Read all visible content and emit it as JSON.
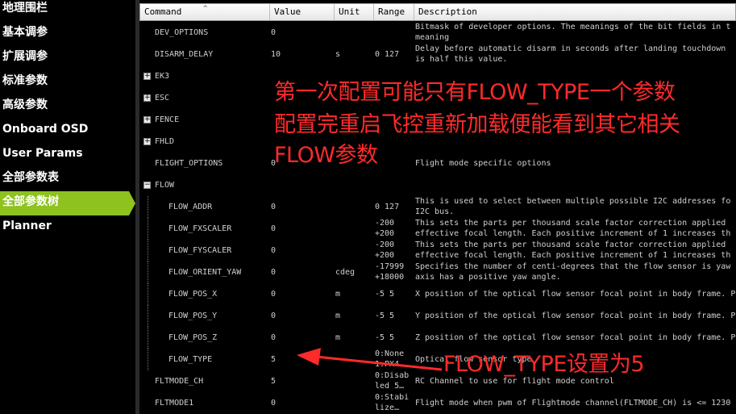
{
  "sidebar": {
    "items": [
      {
        "label": "地理围栏",
        "active": false
      },
      {
        "label": "基本调参",
        "active": false
      },
      {
        "label": "扩展调参",
        "active": false
      },
      {
        "label": "标准参数",
        "active": false
      },
      {
        "label": "高级参数",
        "active": false
      },
      {
        "label": "Onboard OSD",
        "active": false
      },
      {
        "label": "User Params",
        "active": false
      },
      {
        "label": "全部参数表",
        "active": false
      },
      {
        "label": "全部参数树",
        "active": true
      },
      {
        "label": "Planner",
        "active": false
      }
    ]
  },
  "columns": {
    "command": "Command",
    "value": "Value",
    "unit": "Unit",
    "range": "Range",
    "description": "Description"
  },
  "rows": [
    {
      "command": "DEV_OPTIONS",
      "value": "0",
      "unit": "",
      "range": "",
      "description": "Bitmask of developer options. The meanings of the bit fields in t",
      "description2": "meaning",
      "type": "param"
    },
    {
      "command": "DISARM_DELAY",
      "value": "10",
      "unit": "s",
      "range": "0 127",
      "description": "Delay before automatic disarm in seconds after landing touchdown",
      "description2": "is half this value.",
      "type": "param"
    },
    {
      "command": "EK3",
      "type": "group",
      "expander": "+"
    },
    {
      "command": "ESC",
      "type": "group",
      "expander": "+"
    },
    {
      "command": "FENCE",
      "type": "group",
      "expander": "+"
    },
    {
      "command": "FHLD",
      "type": "group",
      "expander": "+"
    },
    {
      "command": "FLIGHT_OPTIONS",
      "value": "0",
      "unit": "",
      "range": "",
      "description": "Flight mode specific options",
      "type": "param"
    },
    {
      "command": "FLOW",
      "type": "group",
      "expander": "−"
    },
    {
      "command": "FLOW_ADDR",
      "value": "0",
      "unit": "",
      "range": "0 127",
      "description": "This is used to select between multiple possible I2C addresses fo",
      "description2": "I2C bus.",
      "type": "child"
    },
    {
      "command": "FLOW_FXSCALER",
      "value": "0",
      "unit": "",
      "range": "-200",
      "range2": "+200",
      "description": "This sets the parts per thousand scale factor correction applied",
      "description2": "effective focal length. Each positive increment of 1 increases th",
      "type": "child"
    },
    {
      "command": "FLOW_FYSCALER",
      "value": "0",
      "unit": "",
      "range": "-200",
      "range2": "+200",
      "description": "This sets the parts per thousand scale factor correction applied",
      "description2": "effective focal length. Each positive increment of 1 increases th",
      "type": "child"
    },
    {
      "command": "FLOW_ORIENT_YAW",
      "value": "0",
      "unit": "cdeg",
      "range": "-17999",
      "range2": "+18000",
      "description": "Specifies the number of centi-degrees that the flow sensor is yaw",
      "description2": "axis has a positive yaw angle.",
      "type": "child"
    },
    {
      "command": "FLOW_POS_X",
      "value": "0",
      "unit": "m",
      "range": "-5 5",
      "description": "X position of the optical flow sensor focal point in body frame. P",
      "type": "child"
    },
    {
      "command": "FLOW_POS_Y",
      "value": "0",
      "unit": "m",
      "range": "-5 5",
      "description": "Y position of the optical flow sensor focal point in body frame. P",
      "type": "child"
    },
    {
      "command": "FLOW_POS_Z",
      "value": "0",
      "unit": "m",
      "range": "-5 5",
      "description": "Z position of the optical flow sensor focal point in body frame. P",
      "type": "child"
    },
    {
      "command": "FLOW_TYPE",
      "value": "5",
      "unit": "",
      "range": "0:None",
      "range2": "1:PX4…",
      "description": "Optical flow sensor type",
      "type": "child"
    },
    {
      "command": "FLTMODE_CH",
      "value": "5",
      "unit": "",
      "range": "0:Disab",
      "range2": "led 5…",
      "description": "RC Channel to use for flight mode control",
      "type": "param"
    },
    {
      "command": "FLTMODE1",
      "value": "0",
      "unit": "",
      "range": "0:Stabi",
      "range2": "lize…",
      "description": "Flight mode when pwm of Flightmode channel(FLTMODE_CH) is <= 1230",
      "type": "param"
    }
  ],
  "annotations": {
    "note_line1": "第一次配置可能只有FLOW_TYPE一个参数",
    "note_line2": "配置完重启飞控重新加载便能看到其它相关",
    "note_line3": "FLOW参数",
    "arrow_label": "FLOW_TYPE设置为5"
  },
  "colors": {
    "sidebar_active": "#8dc21f",
    "annotation_red": "#ff2a2a",
    "background": "#000000"
  }
}
